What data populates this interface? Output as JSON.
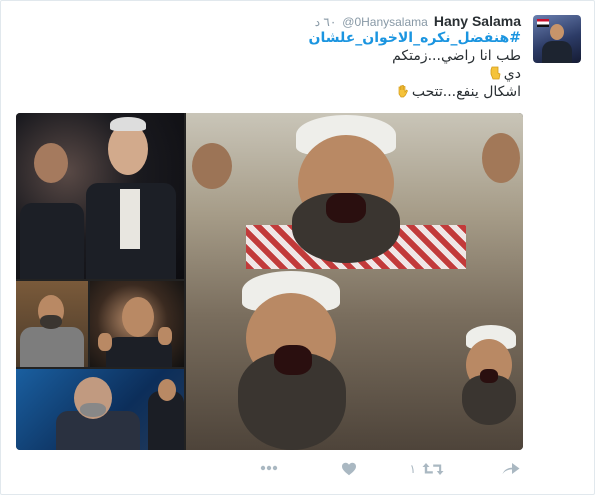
{
  "tweet": {
    "name": "Hany Salama",
    "handle": "@0Hanysalama",
    "time": "٦٠ د",
    "hashtag": "#هنفضل_نكره_الاخوان_علشان",
    "line1": "طب انا راضي...زمتكم",
    "line2": "دي",
    "line3": "اشكال ينفع...تتحب",
    "emoji1": "pointing-down-hand-icon",
    "emoji2": "raised-hand-icon"
  },
  "actions": {
    "retweet_count": "١",
    "reply_icon": "reply-icon",
    "retweet_icon": "retweet-icon",
    "like_icon": "heart-icon",
    "more_icon": "more-icon"
  },
  "colors": {
    "link": "#1b95e0",
    "text": "#292f33",
    "muted": "#8899a6",
    "icon": "#aab8c2"
  }
}
